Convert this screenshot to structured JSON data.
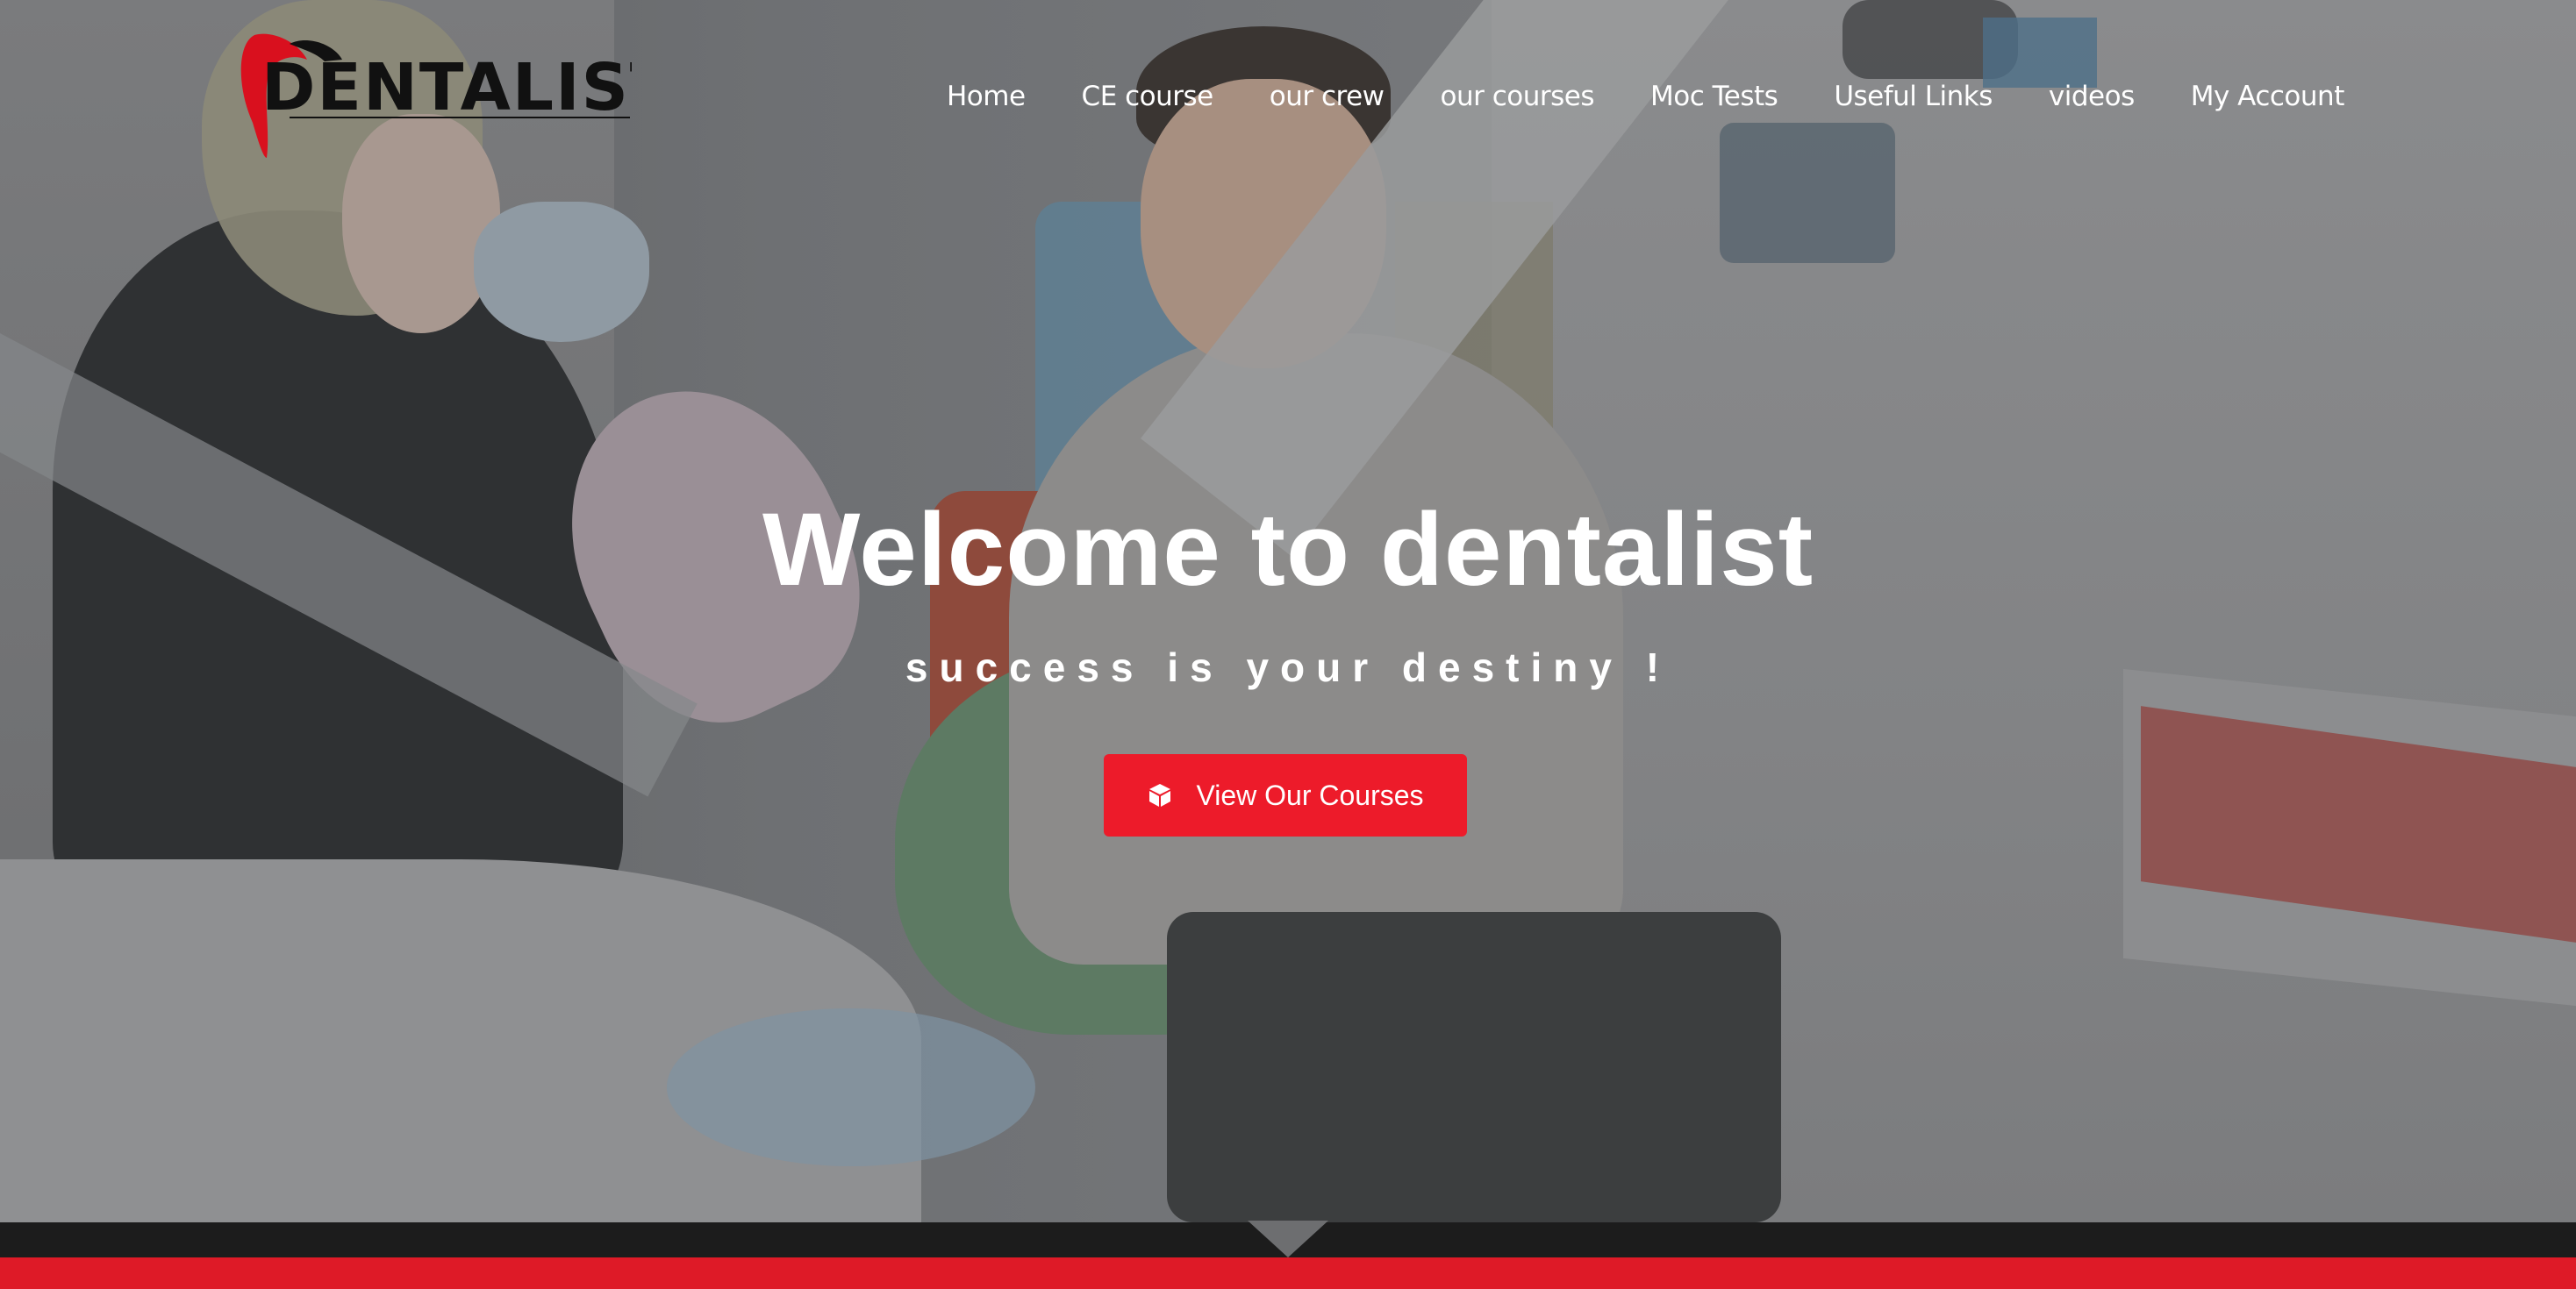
{
  "brand": {
    "name": "DENTALIST",
    "accent_color": "#ed1b2a",
    "logo_icon": "tooth-icon"
  },
  "nav": {
    "items": [
      {
        "label": "Home"
      },
      {
        "label": "CE course"
      },
      {
        "label": "our crew"
      },
      {
        "label": "our courses"
      },
      {
        "label": "Moc Tests"
      },
      {
        "label": "Useful Links"
      },
      {
        "label": "videos"
      },
      {
        "label": "My Account"
      }
    ]
  },
  "hero": {
    "title": "Welcome to dentalist",
    "subtitle": "success is your destiny !",
    "cta": {
      "label": "View Our Courses",
      "icon": "cube-icon",
      "color": "#ed1b2a"
    }
  },
  "footer_band": {
    "dark_color": "#1c1c1c",
    "red_color": "#de1a27"
  }
}
